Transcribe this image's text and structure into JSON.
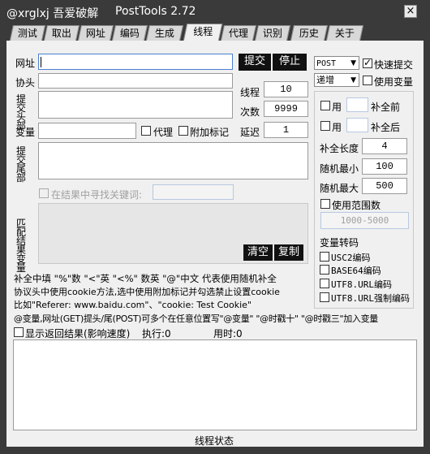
{
  "window": {
    "title_user": "@xrglxj 吾爱破解",
    "title_app": "PostTools 2.72",
    "close_label": "×"
  },
  "tabs": [
    {
      "label": "测试"
    },
    {
      "label": "取出"
    },
    {
      "label": "网址"
    },
    {
      "label": "编码"
    },
    {
      "label": "生成"
    },
    {
      "label": "线程"
    },
    {
      "label": "代理"
    },
    {
      "label": "识别"
    },
    {
      "label": "历史"
    },
    {
      "label": "关于"
    }
  ],
  "active_tab": "线程",
  "form": {
    "url_label": "网址",
    "url_value": "",
    "header_label": "协头",
    "submit_header_label_1": "提交",
    "submit_header_label_2": "头部",
    "variable_label": "变量",
    "proxy_label": "代理",
    "attach_mark_label": "附加标记",
    "submit_tail_label_1": "提交",
    "submit_tail_label_2": "尾部",
    "search_keyword_label": "在结果中寻找关键词:",
    "match_label_1": "匹配",
    "match_label_2": "结果",
    "match_label_3": "变量",
    "submit_button": "提交",
    "stop_button": "停止",
    "thread_label": "线程",
    "thread_value": "10",
    "count_label": "次数",
    "count_value": "9999",
    "delay_label": "延迟",
    "delay_value": "1",
    "clear_button": "清空",
    "copy_button": "复制"
  },
  "right_panel": {
    "method_select": "POST",
    "quick_submit_label": "快速提交",
    "quick_submit_checked": true,
    "mode_select": "递增",
    "use_variable_label": "使用变量",
    "use_label_1": "用",
    "pad_before_label": "补全前",
    "use_label_2": "用",
    "pad_after_label": "补全后",
    "pad_length_label": "补全长度",
    "pad_length_value": "4",
    "random_min_label": "随机最小",
    "random_min_value": "100",
    "random_max_label": "随机最大",
    "random_max_value": "500",
    "use_range_label": "使用范围数",
    "range_value": "1000-5000",
    "var_encode_label": "变量转码",
    "encodings": [
      "USC2编码",
      "BASE64编码",
      "UTF8.URL编码",
      "UTF8.URL强制编码"
    ]
  },
  "help_lines": [
    "补全中填 \"%\"数 \"<\"英 \"<%\" 数英 \"@\"中文  代表使用随机补全",
    "协议头中使用cookie方法,选中使用附加标记并勾选禁止设置cookie",
    "比如\"Referer: www.baidu.com\"、\"cookie: Test Cookie\"",
    "@变量,网址(GET)提头/尾(POST)可多个在任意位置写\"@变量\" \"@时戳十\" \"@时戳三\"加入变量"
  ],
  "results": {
    "show_results_label": "显示返回结果(影响速度)",
    "exec_label": "执行:0",
    "time_label": "用时:0"
  },
  "status_bar": {
    "label": "线程状态"
  }
}
